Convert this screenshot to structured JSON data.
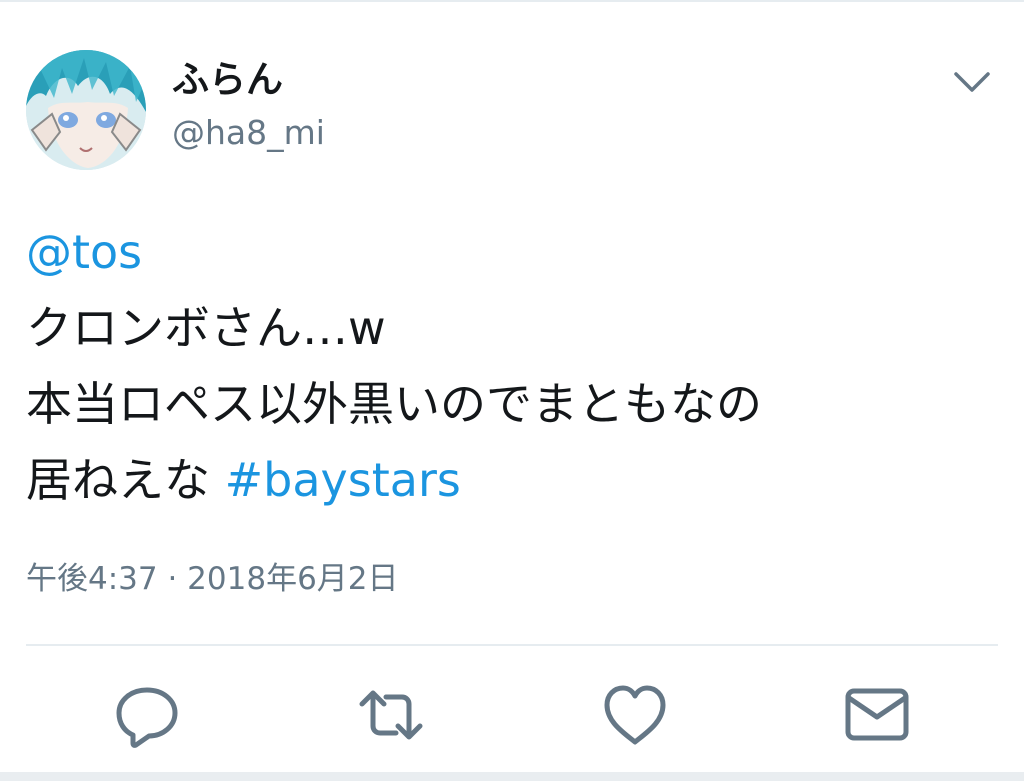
{
  "tweet": {
    "author": {
      "display_name": "ふらん",
      "handle": "@ha8_mi",
      "avatar": "anime-avatar"
    },
    "text_lines": [
      [
        {
          "text": "@tos",
          "link": true
        }
      ],
      [
        {
          "text": "クロンボさん…w",
          "link": false
        }
      ],
      [
        {
          "text": "本当ロペス以外黒いのでまともなの",
          "link": false
        }
      ],
      [
        {
          "text": "居ねえな ",
          "link": false
        },
        {
          "text": "#baystars",
          "link": true
        }
      ]
    ],
    "timestamp": "午後4:37 · 2018年6月2日"
  },
  "actions": [
    {
      "name": "reply",
      "icon": "reply-icon"
    },
    {
      "name": "retweet",
      "icon": "retweet-icon"
    },
    {
      "name": "like",
      "icon": "heart-icon"
    },
    {
      "name": "message",
      "icon": "envelope-icon"
    }
  ],
  "colors": {
    "link": "#1b95e0",
    "text": "#14171a",
    "secondary": "#657786",
    "icon": "#657786",
    "divider": "#e6ecf0"
  }
}
